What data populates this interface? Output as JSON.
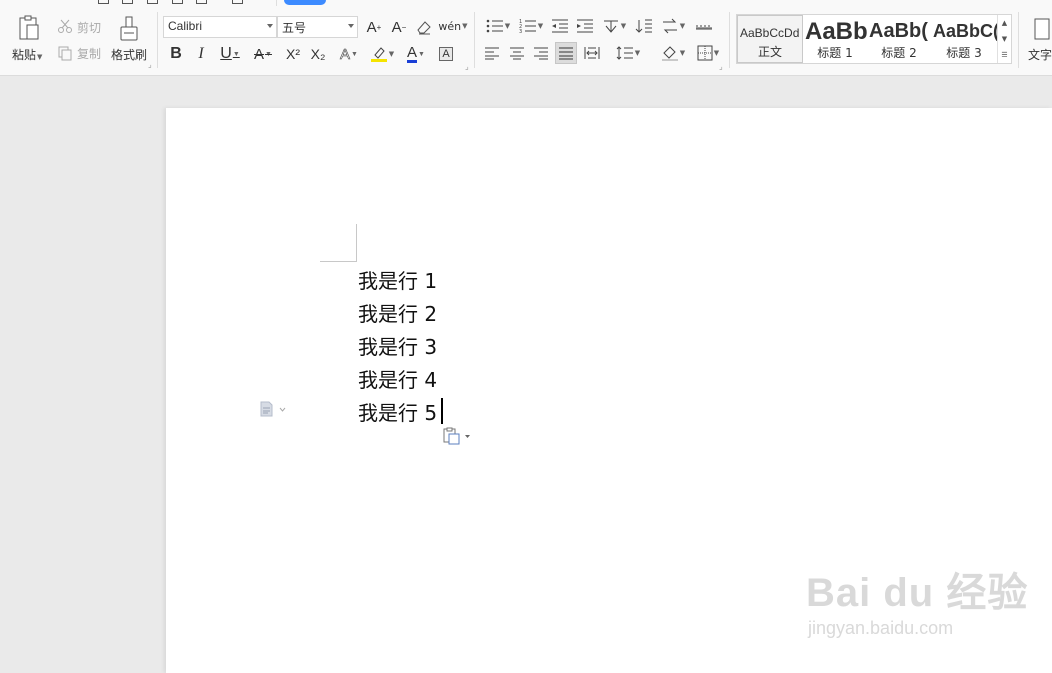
{
  "ribbon": {
    "clipboard": {
      "paste_label": "粘贴",
      "cut_label": "剪切",
      "copy_label": "复制",
      "format_painter_label": "格式刷"
    },
    "font": {
      "font_name": "Calibri",
      "font_size": "五号",
      "bold_glyph": "B",
      "italic_glyph": "I",
      "underline_glyph": "U",
      "strike_glyph": "A",
      "superscript_glyph": "X²",
      "subscript_glyph": "X₂",
      "effects_glyph": "A",
      "font_color_glyph": "A",
      "char_border_glyph": "A",
      "pinyin_glyph": "wén",
      "grow_glyph": "A",
      "shrink_glyph": "A",
      "highlight_color": "#f5e400",
      "font_color": "#1a3fd6"
    },
    "styles": [
      {
        "preview": "AaBbCcDd",
        "caption": "正文"
      },
      {
        "preview": "AaBb",
        "caption": "标题 1"
      },
      {
        "preview": "AaBb(",
        "caption": "标题 2"
      },
      {
        "preview": "AaBbC(",
        "caption": "标题 3"
      }
    ],
    "text_tools_label": "文字",
    "accent_color": "#3d8bff"
  },
  "document": {
    "lines": [
      "我是行 1",
      "我是行 2",
      "我是行 3",
      "我是行 4",
      "我是行 5"
    ]
  },
  "watermark": {
    "brand": "Bai du 经验",
    "url": "jingyan.baidu.com"
  }
}
